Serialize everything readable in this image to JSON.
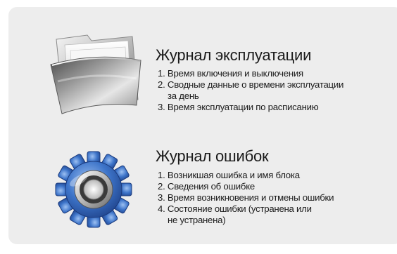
{
  "sections": [
    {
      "icon": "folder-icon",
      "title": "Журнал эксплуатации",
      "items": [
        {
          "number": "1.",
          "text": "Время включения и выключения",
          "cont": ""
        },
        {
          "number": "2.",
          "text": "Сводные данные о времени эксплуатации",
          "cont": "за день"
        },
        {
          "number": "3.",
          "text": "Время эксплуатации по расписанию",
          "cont": ""
        }
      ]
    },
    {
      "icon": "gear-icon",
      "title": "Журнал ошибок",
      "items": [
        {
          "number": "1.",
          "text": "Возникшая ошибка и имя блока",
          "cont": ""
        },
        {
          "number": "2.",
          "text": "Сведения об ошибке",
          "cont": ""
        },
        {
          "number": "3.",
          "text": "Время возникновения и отмены ошибки",
          "cont": ""
        },
        {
          "number": "4.",
          "text": "Состояние ошибки (устранена или",
          "cont": "не устранена)"
        }
      ]
    }
  ],
  "colors": {
    "background": "#ededed",
    "text": "#1a1a1a",
    "gear_blue": "#2f64b8",
    "folder_silver": "#c9c9c9"
  }
}
